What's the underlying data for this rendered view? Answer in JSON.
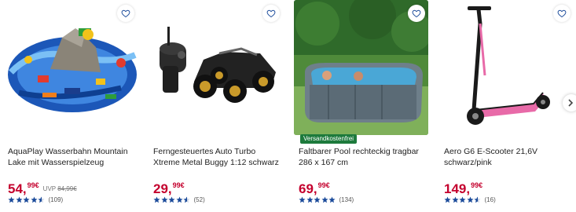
{
  "products": [
    {
      "title": "AquaPlay Wasserbahn Mountain Lake mit Wasserspielzeug",
      "price_main": "54,",
      "price_cents": "99€",
      "uvp_label": "UVP",
      "uvp_price": "84,99€",
      "rating": 4.5,
      "rating_count": "(109)",
      "badge": ""
    },
    {
      "title": "Ferngesteuertes Auto Turbo Xtreme Metal Buggy 1:12 schwarz",
      "price_main": "29,",
      "price_cents": "99€",
      "uvp_label": "",
      "uvp_price": "",
      "rating": 4.5,
      "rating_count": "(52)",
      "badge": ""
    },
    {
      "title": "Faltbarer Pool rechteckig tragbar 286 x 167 cm",
      "price_main": "69,",
      "price_cents": "99€",
      "uvp_label": "",
      "uvp_price": "",
      "rating": 5,
      "rating_count": "(134)",
      "badge": "Versandkostenfrei"
    },
    {
      "title": "Aero G6 E-Scooter 21,6V schwarz/pink",
      "price_main": "149,",
      "price_cents": "99€",
      "uvp_label": "",
      "uvp_price": "",
      "rating": 4.5,
      "rating_count": "(16)",
      "badge": ""
    }
  ],
  "icons": {
    "wishlist": "heart-outline-icon",
    "rating_star": "star-icon",
    "next": "chevron-right-icon"
  },
  "colors": {
    "price": "#c4002d",
    "star": "#1a4a9a",
    "badge": "#1d7a3c"
  }
}
